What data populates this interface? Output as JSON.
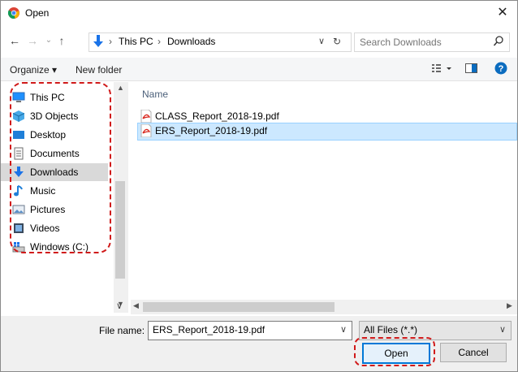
{
  "window": {
    "title": "Open",
    "close_glyph": "✕"
  },
  "address_bar": {
    "segments": [
      "This PC",
      "Downloads"
    ],
    "separator": "›"
  },
  "search": {
    "placeholder": "Search Downloads"
  },
  "toolbar": {
    "organize_label": "Organize ▾",
    "new_folder_label": "New folder"
  },
  "file_list": {
    "column_name": "Name",
    "files": [
      {
        "name": "CLASS_Report_2018-19.pdf",
        "selected": false
      },
      {
        "name": "ERS_Report_2018-19.pdf",
        "selected": true
      }
    ]
  },
  "sidebar": {
    "items": [
      {
        "label": "This PC",
        "icon": "computer-icon"
      },
      {
        "label": "3D Objects",
        "icon": "cube-icon"
      },
      {
        "label": "Desktop",
        "icon": "desktop-icon"
      },
      {
        "label": "Documents",
        "icon": "document-icon"
      },
      {
        "label": "Downloads",
        "icon": "download-arrow-icon",
        "selected": true
      },
      {
        "label": "Music",
        "icon": "music-note-icon"
      },
      {
        "label": "Pictures",
        "icon": "picture-icon"
      },
      {
        "label": "Videos",
        "icon": "film-icon"
      },
      {
        "label": "Windows (C:)",
        "icon": "drive-icon"
      }
    ]
  },
  "footer": {
    "file_name_label": "File name:",
    "file_name_value": "ERS_Report_2018-19.pdf",
    "file_type_value": "All Files (*.*)",
    "open_label": "Open",
    "cancel_label": "Cancel"
  },
  "colors": {
    "accent": "#0078d7",
    "selection": "#cce8ff",
    "annotation": "#d01a1a"
  }
}
